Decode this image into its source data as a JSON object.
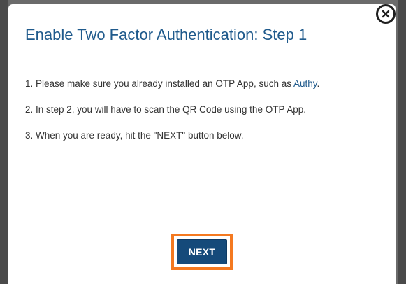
{
  "modal": {
    "title": "Enable Two Factor Authentication: Step 1",
    "steps": {
      "step1_text": "1. Please make sure you already installed an OTP App, such as",
      "step1_link": "Authy",
      "step2_text": "2. In step 2, you will have to scan the QR Code using the OTP App.",
      "step3_text": "3. When you are ready, hit the \"NEXT\" button below."
    },
    "next_label": "NEXT",
    "close_icon": "close-icon"
  },
  "colors": {
    "title": "#1f5a8c",
    "link": "#1f5a8c",
    "button": "#154a7a",
    "highlight": "#f47920",
    "overlay": "#6b6b6b"
  }
}
